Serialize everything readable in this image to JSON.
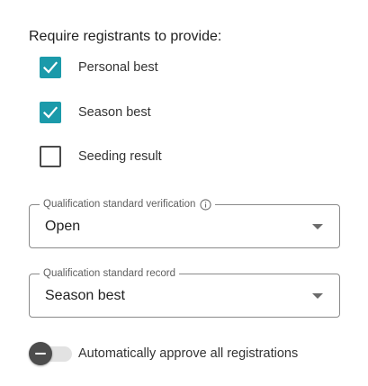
{
  "requirements": {
    "title": "Require registrants to provide:",
    "items": [
      {
        "label": "Personal best",
        "checked": true
      },
      {
        "label": "Season best",
        "checked": true
      },
      {
        "label": "Seeding result",
        "checked": false
      }
    ]
  },
  "verification_select": {
    "label": "Qualification standard verification",
    "value": "Open",
    "icon": "info-icon"
  },
  "record_select": {
    "label": "Qualification standard record",
    "value": "Season best"
  },
  "auto_approve": {
    "label": "Automatically approve all registrations",
    "enabled": false
  },
  "colors": {
    "accent": "#1b9aaa",
    "border": "#8a8a8a",
    "toggle_thumb": "#4d4d4d"
  }
}
